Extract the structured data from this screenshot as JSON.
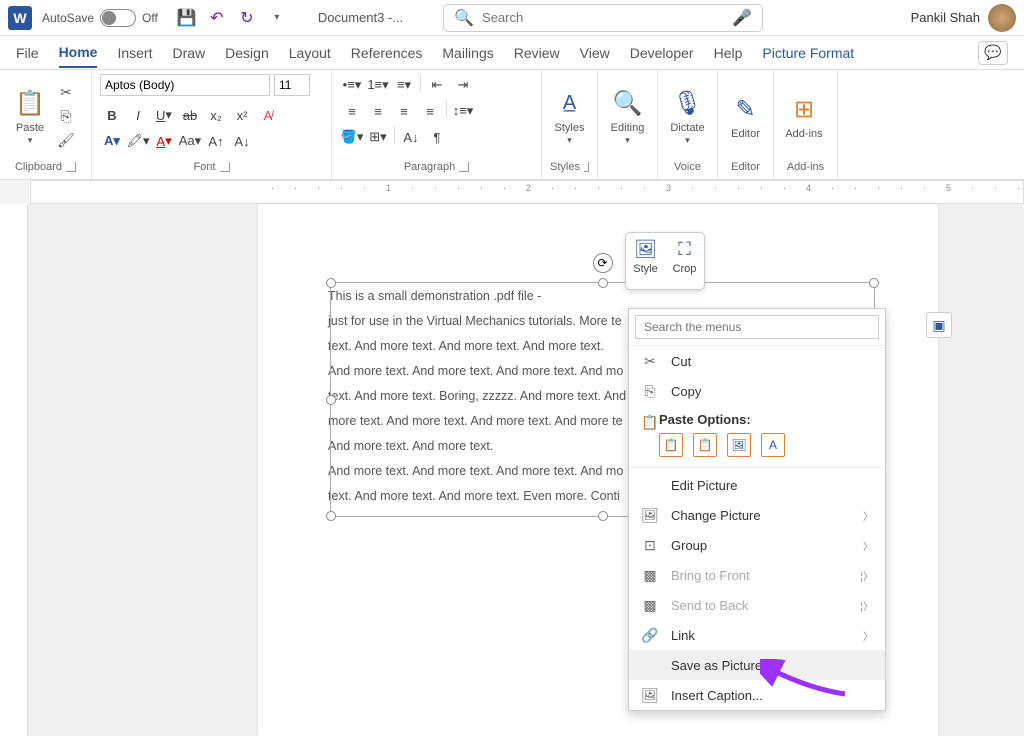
{
  "titlebar": {
    "autosave_label": "AutoSave",
    "autosave_state": "Off",
    "doc_title": "Document3 -...",
    "search_placeholder": "Search",
    "user_name": "Pankil Shah"
  },
  "tabs": [
    "File",
    "Home",
    "Insert",
    "Draw",
    "Design",
    "Layout",
    "References",
    "Mailings",
    "Review",
    "View",
    "Developer",
    "Help",
    "Picture Format"
  ],
  "ribbon": {
    "groups": [
      "Clipboard",
      "Font",
      "Paragraph",
      "Styles",
      "Editing",
      "Voice",
      "Editor",
      "Add-ins"
    ],
    "paste": "Paste",
    "font_name": "Aptos (Body)",
    "font_size": "11",
    "styles": "Styles",
    "editing": "Editing",
    "dictate": "Dictate",
    "editor": "Editor",
    "addins": "Add-ins"
  },
  "mini": {
    "style": "Style",
    "crop": "Crop"
  },
  "doc_lines": [
    "This is a small demonstration .pdf file -",
    "just for use in the Virtual Mechanics tutorials. More te",
    "text. And more text. And more text. And more text.",
    "And more text. And more text. And more text. And mo",
    "text. And more text. Boring, zzzzz. And more text. And",
    "more text. And more text. And more text. And more te",
    "And more text. And more text.",
    "And more text. And more text. And more text. And mo",
    "text. And more text. And more text. Even more. Conti"
  ],
  "context_menu": {
    "search_placeholder": "Search the menus",
    "cut": "Cut",
    "copy": "Copy",
    "paste_options": "Paste Options:",
    "edit_picture": "Edit Picture",
    "change_picture": "Change Picture",
    "group": "Group",
    "bring_front": "Bring to Front",
    "send_back": "Send to Back",
    "link": "Link",
    "save_as_picture": "Save as Picture...",
    "insert_caption": "Insert Caption..."
  }
}
